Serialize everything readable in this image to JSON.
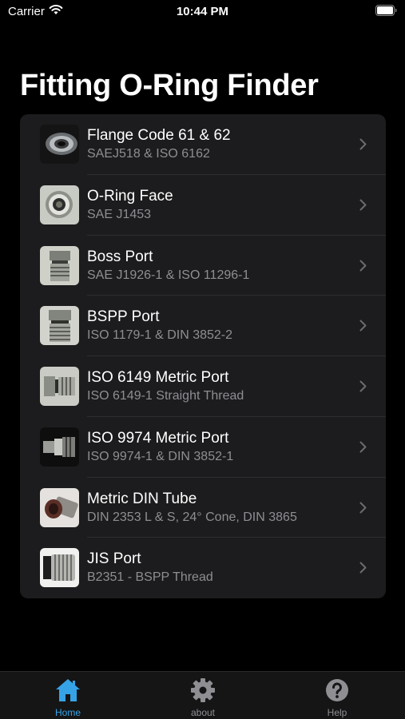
{
  "status_bar": {
    "carrier": "Carrier",
    "time": "10:44 PM"
  },
  "page": {
    "title": "Fitting O-Ring Finder"
  },
  "items": [
    {
      "title": "Flange Code 61 & 62",
      "subtitle": "SAEJ518 & ISO 6162",
      "icon": "flange-fitting-photo"
    },
    {
      "title": "O-Ring Face",
      "subtitle": "SAE J1453",
      "icon": "oring-face-fitting-photo"
    },
    {
      "title": "Boss Port",
      "subtitle": "SAE J1926-1 & ISO 11296-1",
      "icon": "boss-port-fitting-photo"
    },
    {
      "title": "BSPP Port",
      "subtitle": "ISO 1179-1 & DIN 3852-2",
      "icon": "bspp-port-fitting-photo"
    },
    {
      "title": "ISO 6149 Metric Port",
      "subtitle": "ISO 6149-1 Straight Thread",
      "icon": "iso6149-fitting-photo"
    },
    {
      "title": "ISO 9974 Metric Port",
      "subtitle": "ISO 9974-1 & DIN 3852-1",
      "icon": "iso9974-fitting-photo"
    },
    {
      "title": "Metric DIN Tube",
      "subtitle": "DIN 2353 L & S, 24° Cone, DIN 3865",
      "icon": "din-tube-fitting-photo"
    },
    {
      "title": "JIS Port",
      "subtitle": "B2351 - BSPP Thread",
      "icon": "jis-port-fitting-photo"
    }
  ],
  "tabs": [
    {
      "label": "Home",
      "icon": "home-icon",
      "active": true
    },
    {
      "label": "about",
      "icon": "gear-icon",
      "active": false
    },
    {
      "label": "Help",
      "icon": "question-icon",
      "active": false
    }
  ],
  "colors": {
    "accent": "#36a3e6",
    "list_bg": "#1c1c1e",
    "secondary_text": "#8e8e93"
  }
}
